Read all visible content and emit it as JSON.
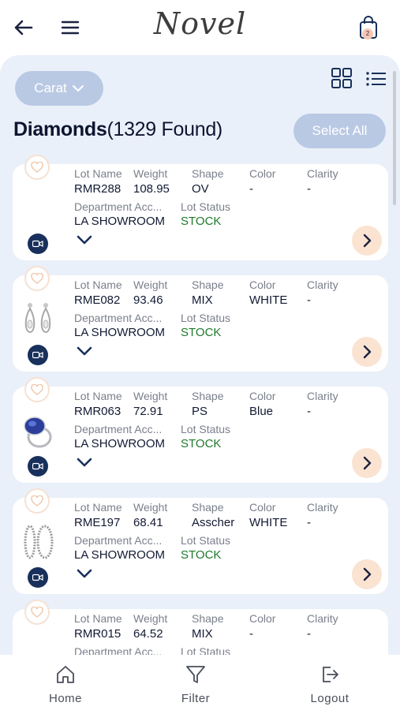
{
  "header": {
    "logo": "Novel",
    "cart_count": "2"
  },
  "toolbar": {
    "filter_label": "Carat",
    "select_all_label": "Select All"
  },
  "title": {
    "main": "Diamonds",
    "count": "(1329 Found)"
  },
  "labels": {
    "lot_name": "Lot Name",
    "weight": "Weight",
    "shape": "Shape",
    "color": "Color",
    "clarity": "Clarity",
    "department": "Department Acc...",
    "lot_status": "Lot Status"
  },
  "items": [
    {
      "lot_name": "RMR288",
      "weight": "108.95",
      "shape": "OV",
      "color": "-",
      "clarity": "-",
      "department": "LA SHOWROOM",
      "status": "STOCK",
      "thumb": "none"
    },
    {
      "lot_name": "RME082",
      "weight": "93.46",
      "shape": "MIX",
      "color": "WHITE",
      "clarity": "-",
      "department": "LA SHOWROOM",
      "status": "STOCK",
      "thumb": "earrings-icon"
    },
    {
      "lot_name": "RMR063",
      "weight": "72.91",
      "shape": "PS",
      "color": "Blue",
      "clarity": "-",
      "department": "LA SHOWROOM",
      "status": "STOCK",
      "thumb": "sapphire-ring-icon"
    },
    {
      "lot_name": "RME197",
      "weight": "68.41",
      "shape": "Asscher",
      "color": "WHITE",
      "clarity": "-",
      "department": "LA SHOWROOM",
      "status": "STOCK",
      "thumb": "hoop-earrings-icon"
    },
    {
      "lot_name": "RMR015",
      "weight": "64.52",
      "shape": "MIX",
      "color": "-",
      "clarity": "-",
      "department": "",
      "status": "",
      "thumb": "none"
    }
  ],
  "bottom_nav": {
    "home": "Home",
    "filter": "Filter",
    "logout": "Logout"
  },
  "colors": {
    "accent": "#b9c9e4",
    "navy": "#18305b",
    "peach": "#fbe3d1",
    "stock": "#1e7a2c",
    "background": "#eaf0f9"
  }
}
